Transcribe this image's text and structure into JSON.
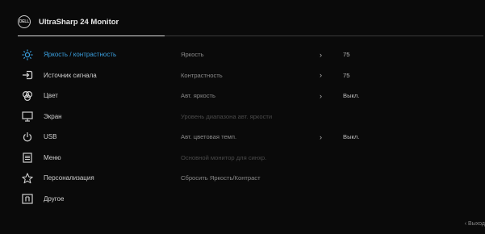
{
  "window": {
    "logo_text": "DELL",
    "title": "UltraSharp 24 Monitor"
  },
  "sidebar": {
    "items": [
      {
        "label": "Яркость / контрастность",
        "icon": "sun-icon",
        "active": true
      },
      {
        "label": "Источник сигнала",
        "icon": "input-source-icon",
        "active": false
      },
      {
        "label": "Цвет",
        "icon": "color-palette-icon",
        "active": false
      },
      {
        "label": "Экран",
        "icon": "display-icon",
        "active": false
      },
      {
        "label": "USB",
        "icon": "usb-power-icon",
        "active": false
      },
      {
        "label": "Меню",
        "icon": "menu-list-icon",
        "active": false
      },
      {
        "label": "Персонализация",
        "icon": "star-icon",
        "active": false
      },
      {
        "label": "Другое",
        "icon": "info-box-icon",
        "active": false
      }
    ]
  },
  "settings": {
    "rows": [
      {
        "label": "Яркость",
        "chevron": "›",
        "value": "75",
        "enabled": true
      },
      {
        "label": "Контрастность",
        "chevron": "›",
        "value": "75",
        "enabled": true
      },
      {
        "label": "Авт. яркость",
        "chevron": "›",
        "value": "Выкл.",
        "enabled": true
      },
      {
        "label": "Уровень диапазона авт. яркости",
        "chevron": "",
        "value": "",
        "enabled": false
      },
      {
        "label": "Авт. цветовая темп.",
        "chevron": "›",
        "value": "Выкл.",
        "enabled": true
      },
      {
        "label": "Основной монитор для синхр.",
        "chevron": "",
        "value": "",
        "enabled": false
      },
      {
        "label": "Сбросить Яркость/Контраст",
        "chevron": "",
        "value": "",
        "enabled": true
      }
    ]
  },
  "footer": {
    "exit_label": "‹ Выход"
  },
  "colors": {
    "accent": "#3aa0e0",
    "background": "#0a0a0a",
    "text": "#cfcfcf",
    "disabled": "#4a4a4a"
  }
}
